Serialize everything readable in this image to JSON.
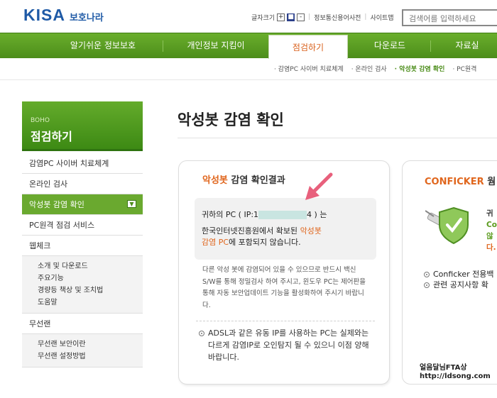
{
  "header": {
    "logo_main": "KISA",
    "logo_sub": "보호나라",
    "font_size_label": "글자크기",
    "font_plus": "+",
    "font_default": "■",
    "font_minus": "-",
    "link_dictionary": "정보통신용어사전",
    "link_sitemap": "사이트맵",
    "search_placeholder": "검색어를 입력하세요"
  },
  "nav": {
    "items": [
      {
        "label": "알기쉬운 정보보호"
      },
      {
        "label": "개인정보 지킴이"
      },
      {
        "label": "점검하기"
      },
      {
        "label": "다운로드"
      },
      {
        "label": "자료실"
      }
    ],
    "active_index": 2
  },
  "subnav": {
    "items": [
      "· 감염PC 사이버 치료체계",
      "· 온라인 검사",
      "· 악성봇 감염 확인",
      "· PC원격"
    ],
    "selected_index": 2
  },
  "sidebar": {
    "head_small": "BOHO",
    "head_title": "점검하기",
    "items": [
      {
        "label": "감염PC 사이버 치료체계"
      },
      {
        "label": "온라인 검사"
      },
      {
        "label": "악성봇 감염 확인"
      },
      {
        "label": "PC원격 점검 서비스"
      },
      {
        "label": "웹체크"
      }
    ],
    "webcheck_sub": [
      "소개 및 다운로드",
      "주요기능",
      "경량등 책상 및 조치법",
      "도움말"
    ],
    "wireless_label": "무선랜",
    "wireless_sub": [
      "무선랜 보안이란",
      "무선랜 설정방법"
    ]
  },
  "main": {
    "page_title": "악성봇 감염 확인",
    "card": {
      "title_orange": "악성봇",
      "title_rest": " 감염 확인결과",
      "result_line1_prefix": "귀하의 PC ( IP:1",
      "result_line1_suffix": "4 ) 는",
      "result_line2_prefix": "한국인터넷진흥원에서 확보된 ",
      "result_line2_orange": "악성봇",
      "result_line3_orange": "감염 PC",
      "result_line3_suffix": "에 포함되지 않습니다.",
      "description": "다른 악성 봇에 감염되어 있을 수 있으므로 반드시 백신 S/W를 통해 정밀검사 하여 주시고, 윈도우 PC는 제어판을 통해 자동 보안업데이트 기능을 활성화하여 주시기 바랍니다.",
      "note": "ADSL과 같은 유동 IP를 사용하는 PC는 실제와는 다르게 감염IP로 오인탐지 될 수 있으니 이점 양해 바랍니다."
    },
    "card2": {
      "title_orange": "CONFICKER",
      "title_rest": " 웜",
      "side_lines": [
        "귀",
        "Co",
        "않",
        "다."
      ],
      "list": [
        "Conficker 전용백",
        "관련 공지사항 확"
      ]
    }
  },
  "watermark": {
    "line1": "얼음달님FTA상",
    "line2": "http://ldsong.com"
  }
}
